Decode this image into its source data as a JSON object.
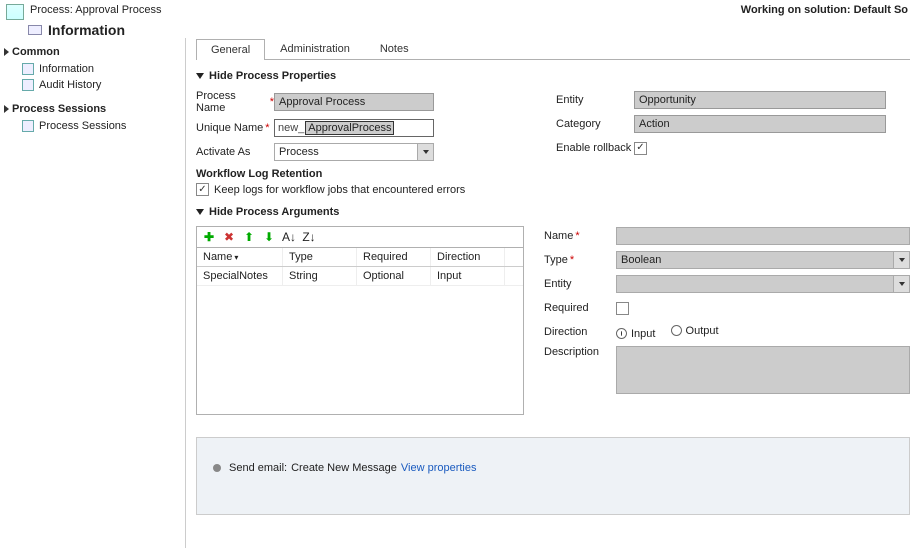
{
  "header": {
    "process_label": "Process: Approval Process",
    "working": "Working on solution: Default So",
    "title": "Information"
  },
  "sidebar": {
    "common_head": "Common",
    "items_common": [
      "Information",
      "Audit History"
    ],
    "sessions_head": "Process Sessions",
    "items_sessions": [
      "Process Sessions"
    ]
  },
  "tabs": [
    "General",
    "Administration",
    "Notes"
  ],
  "sections": {
    "hide_props": "Hide Process Properties",
    "hide_args": "Hide Process Arguments"
  },
  "props": {
    "process_name_label": "Process Name",
    "process_name_value": "Approval Process",
    "unique_name_label": "Unique Name",
    "unique_prefix": "new_",
    "unique_value": "ApprovalProcess",
    "activate_as_label": "Activate As",
    "activate_as_value": "Process",
    "entity_label": "Entity",
    "entity_value": "Opportunity",
    "category_label": "Category",
    "category_value": "Action",
    "rollback_label": "Enable rollback",
    "log_head": "Workflow Log Retention",
    "log_text": "Keep logs for workflow jobs that encountered errors"
  },
  "args_grid": {
    "headers": [
      "Name",
      "Type",
      "Required",
      "Direction"
    ],
    "row": [
      "SpecialNotes",
      "String",
      "Optional",
      "Input"
    ]
  },
  "args_form": {
    "name_label": "Name",
    "type_label": "Type",
    "type_value": "Boolean",
    "entity_label": "Entity",
    "required_label": "Required",
    "direction_label": "Direction",
    "dir_input": "Input",
    "dir_output": "Output",
    "desc_label": "Description"
  },
  "step": {
    "label": "Send email:",
    "value": "Create New Message",
    "link": "View properties"
  }
}
